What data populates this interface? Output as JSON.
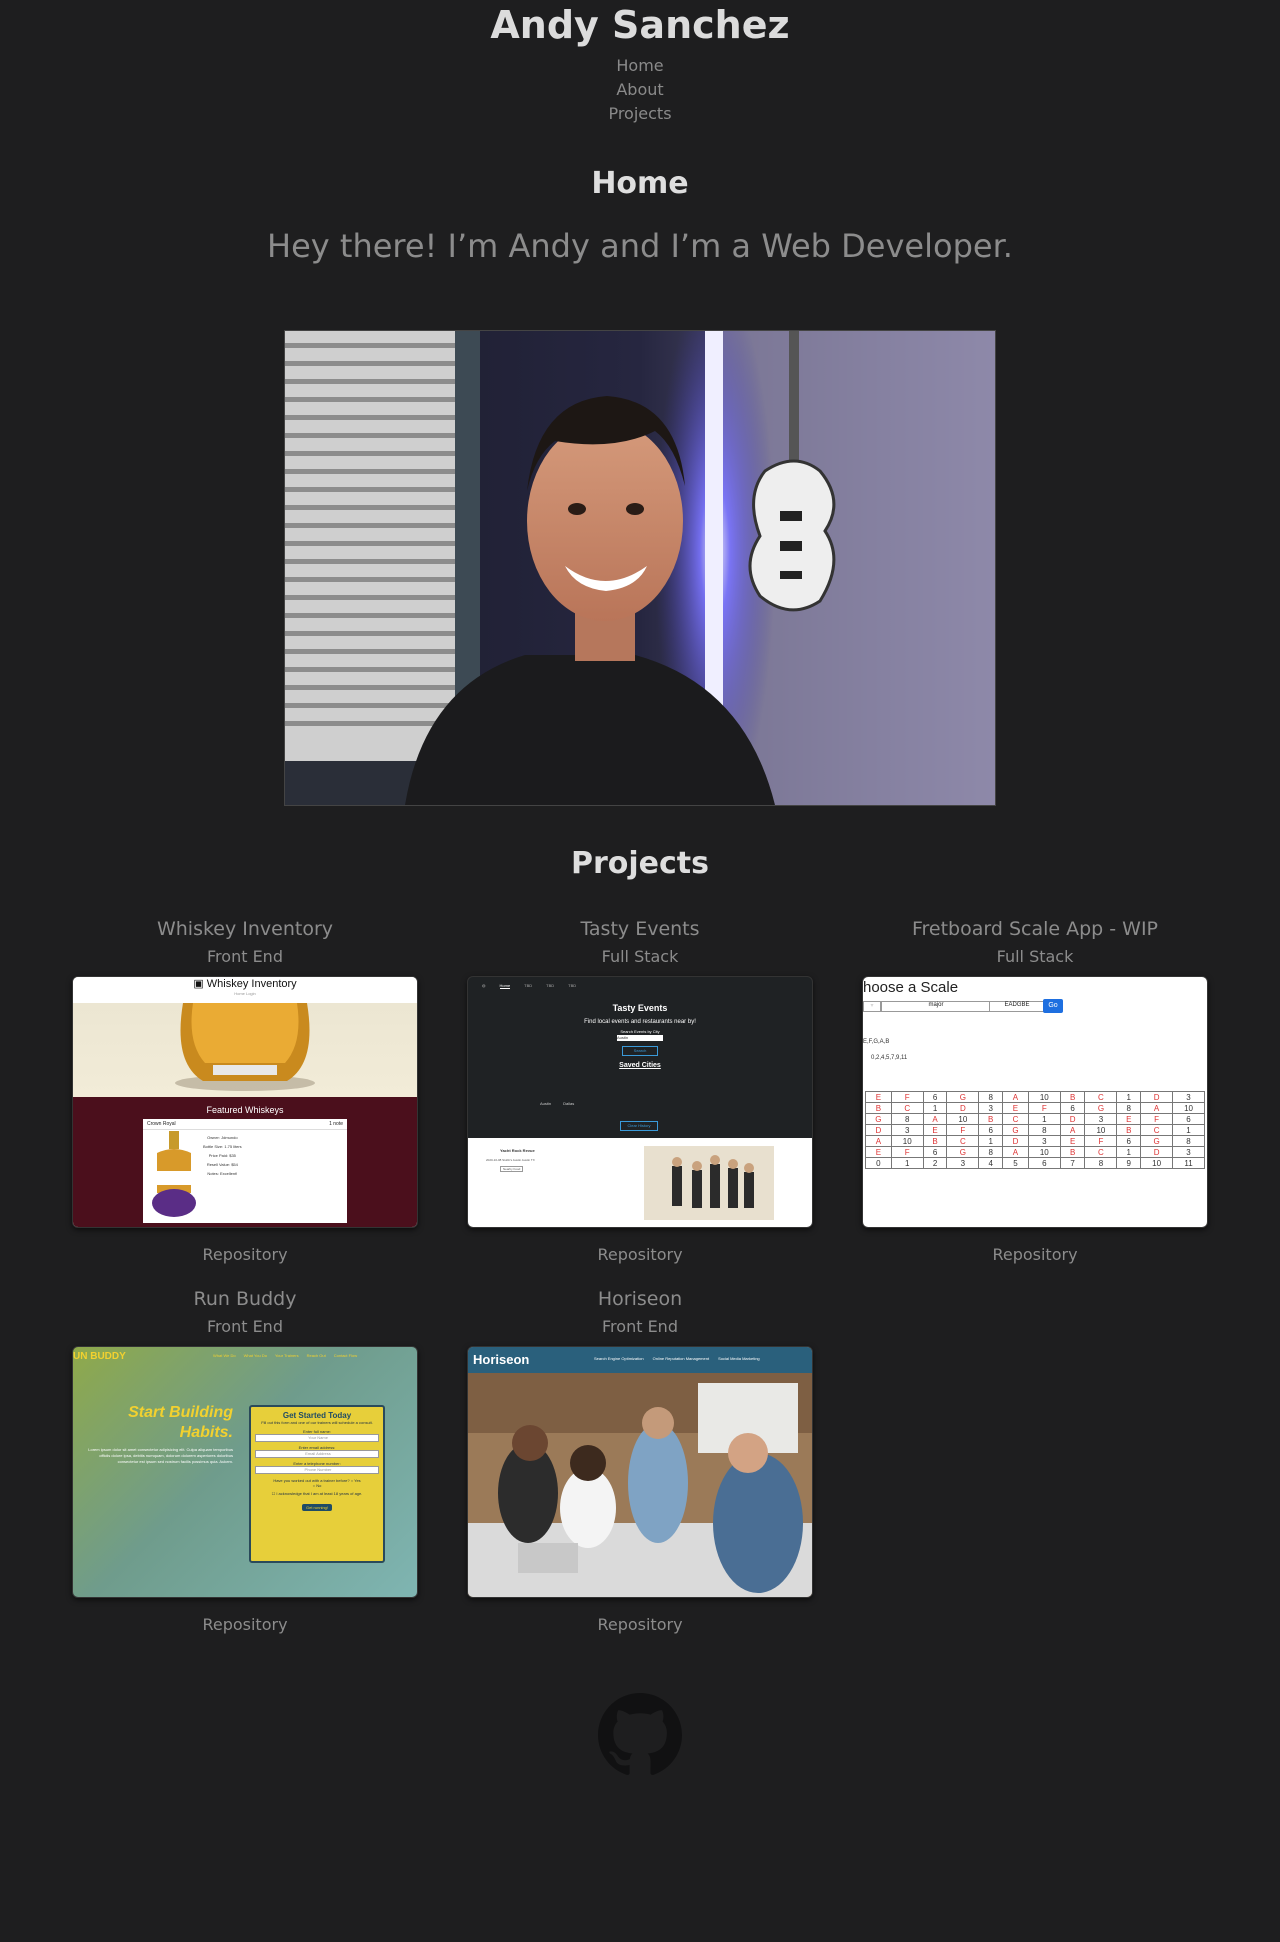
{
  "site": {
    "title": "Andy Sanchez"
  },
  "nav": {
    "items": [
      "Home",
      "About",
      "Projects"
    ]
  },
  "home": {
    "title": "Home",
    "tagline": "Hey there! I’m Andy and I’m a Web Developer."
  },
  "projects": {
    "title": "Projects",
    "link_label": "Repository",
    "items": [
      {
        "name": "Whiskey Inventory",
        "type": "Front End"
      },
      {
        "name": "Tasty Events",
        "type": "Full Stack"
      },
      {
        "name": "Fretboard Scale App - WIP",
        "type": "Full Stack"
      },
      {
        "name": "Run Buddy",
        "type": "Front End"
      },
      {
        "name": "Horiseon",
        "type": "Front End"
      }
    ]
  },
  "screens": {
    "whiskey": {
      "title": "Whiskey Inventory",
      "nav": "Home  Login",
      "featured": "Featured Whiskeys",
      "card_title": "Crown Royal",
      "card_badge": "1 note",
      "details": [
        "Owner: Jdmundo",
        "Bottle Size: 1.75 liters",
        "Price Paid: $35",
        "Resell Value: $54",
        "Notes: Excellent!"
      ]
    },
    "tasty": {
      "title": "Tasty Events",
      "subtitle": "Find local events and restaurants near by!",
      "input_label": "Search Events by City",
      "input_value": "Austin",
      "search_btn": "Search",
      "saved": "Saved Cities",
      "cities": [
        "Austin",
        "Dallas"
      ],
      "clear_btn": "Clear History",
      "event": "Yacht Rock Revue",
      "event_info": "2020-10-08 Stubb's Austin Austin TX",
      "nearby_btn": "Nearby Food",
      "tabs": [
        "Home",
        "TBD",
        "TBD",
        "TBD"
      ]
    },
    "fret": {
      "heading": "hoose a Scale",
      "scale_value": "major",
      "tuning_value": "EADGBE",
      "go_btn": "Go",
      "notes": "E,F,G,A,B",
      "intervals": "0,2,4,5,7,9,11"
    },
    "runbuddy": {
      "brand": "UN BUDDY",
      "nav": [
        "What We Do",
        "What You Do",
        "Your Trainers",
        "Reach Out",
        "Contact Flow"
      ],
      "hero_line1": "Start Building",
      "hero_line2": "Habits.",
      "hero_text": "Lorem ipsum dolor sit amet consectetur adipisicing elit. Culpa aliquam temporibus officiis dolore ipsa, debitis numquam, dolorum dolorem asperiores doloribus consectetur est ipsum sed nostrum facilis possimus quia. Aukem.",
      "form_title": "Get Started Today",
      "form_intro": "Fill out this form and one of our trainers will schedule a consult.",
      "labels": [
        "Enter full name:",
        "Enter email address:",
        "Enter a telephone number:"
      ],
      "placeholders": [
        "Your Name",
        "Email Address",
        "Phone Number"
      ],
      "question": "Have you worked out with a trainer before?",
      "yes": "Yes",
      "no": "No",
      "ack": "I acknowledge that I am at least 18 years of age.",
      "cta": "Get running!"
    },
    "horiseon": {
      "brand": "Horiseon",
      "nav": [
        "Search Engine Optimization",
        "Online Reputation Management",
        "Social Media Marketing"
      ]
    }
  },
  "footer": {
    "icon": "github-icon"
  }
}
